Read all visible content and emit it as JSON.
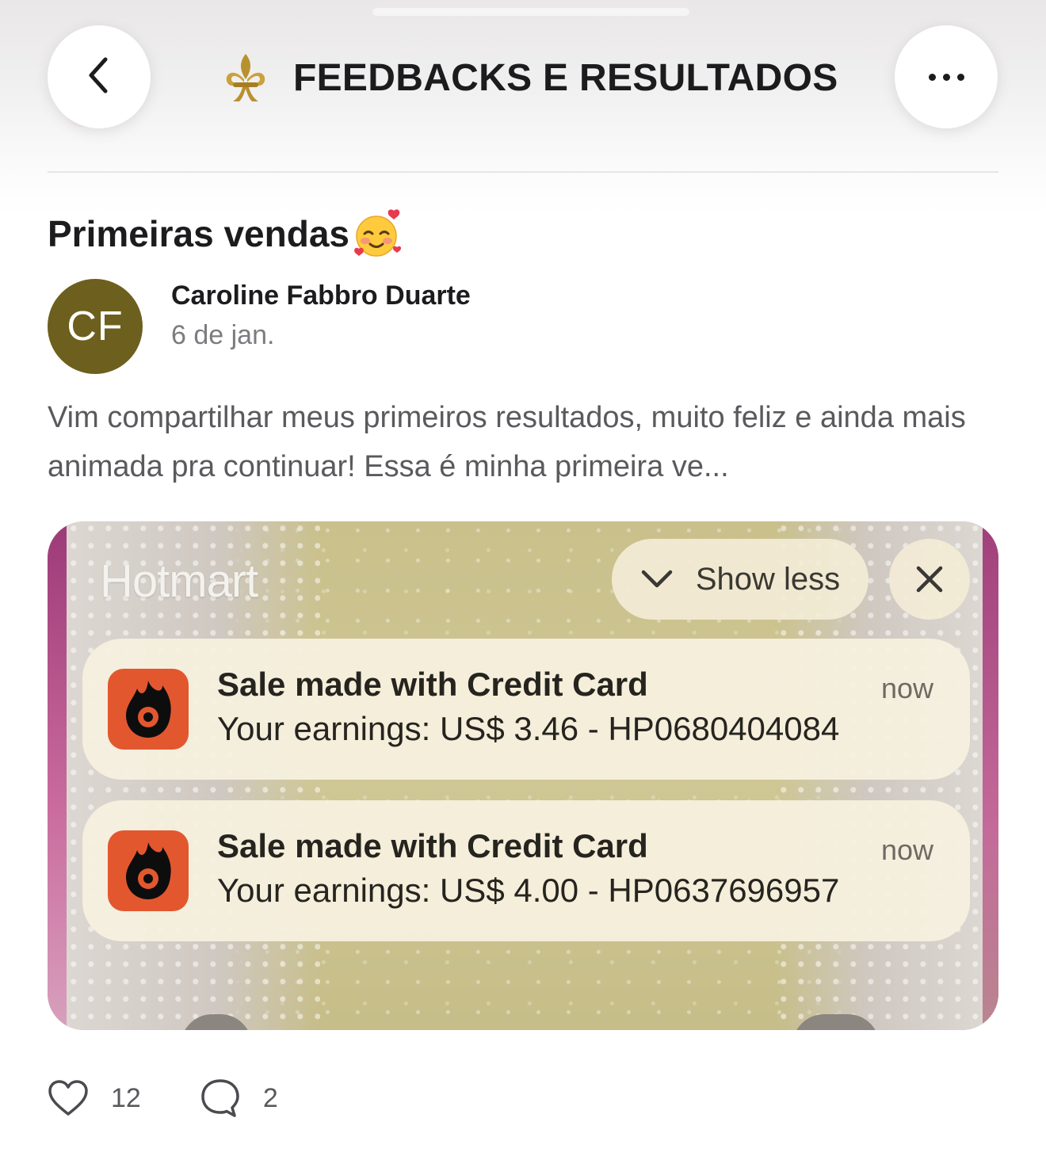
{
  "header": {
    "title": "FEEDBACKS E RESULTADOS",
    "back_icon": "chevron-left-icon",
    "more_icon": "ellipsis-icon",
    "title_icon": "fleur-de-lis-icon"
  },
  "post": {
    "title": "Primeiras vendas",
    "title_emoji": "smiling-face-with-hearts",
    "author": {
      "initials": "CF",
      "name": "Caroline Fabbro Duarte",
      "avatar_color": "#6d5f1d"
    },
    "date": "6 de jan.",
    "body": "Vim compartilhar meus primeiros resultados, muito feliz  e ainda mais animada pra continuar! Essa é minha primeira ve...",
    "image": {
      "app_name": "Hotmart",
      "show_less_label": "Show less",
      "notifications": [
        {
          "title": "Sale made with Credit Card",
          "time": "now",
          "body": "Your earnings: US$ 3.46 - HP0680404084"
        },
        {
          "title": "Sale made with Credit Card",
          "time": "now",
          "body": "Your earnings: US$ 4.00 - HP0637696957"
        }
      ],
      "accent_color": "#e3572f"
    },
    "likes": "12",
    "comments": "2"
  }
}
